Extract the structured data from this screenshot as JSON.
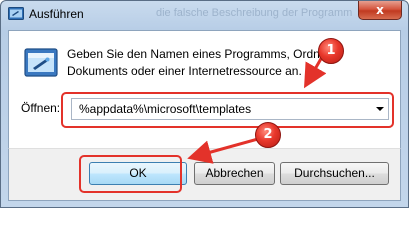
{
  "window": {
    "title": "Ausführen",
    "background_title_fragment": "die falsche Beschreibung der Programm",
    "close_symbol": "x"
  },
  "dialog": {
    "description": "Geben Sie den Namen eines Programms, Ordners, Dokuments oder einer Internetressource an.",
    "open_label": "Öffnen:",
    "open_value": "%appdata%\\microsoft\\templates",
    "ok_label": "OK",
    "cancel_label": "Abbrechen",
    "browse_label": "Durchsuchen..."
  },
  "annotations": {
    "step1": "1",
    "step2": "2",
    "highlight_color": "#e3322a"
  },
  "icons": {
    "title": "run-icon",
    "dialog": "run-app-icon",
    "dropdown": "chevron-down-icon"
  }
}
